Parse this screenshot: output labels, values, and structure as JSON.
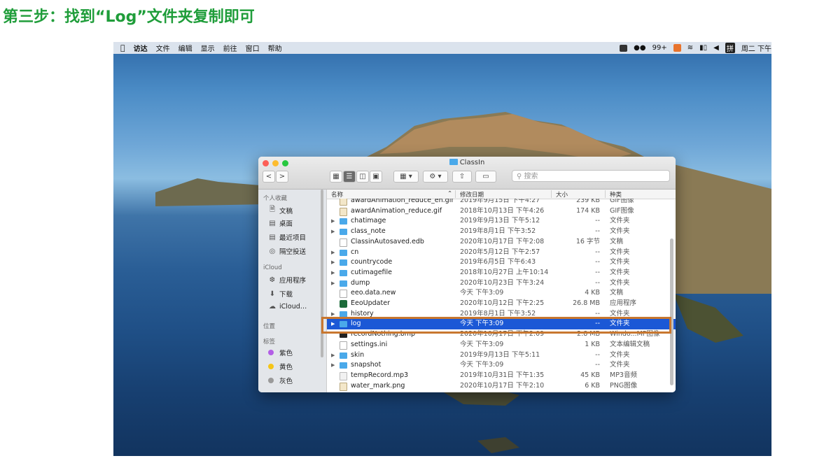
{
  "heading": "第三步：找到“Log”文件夹复制即可",
  "menubar": {
    "apple": "",
    "items": [
      "访达",
      "文件",
      "编辑",
      "显示",
      "前往",
      "窗口",
      "帮助"
    ],
    "badge": "99+",
    "input_method": "拼",
    "clock": "周二 下午"
  },
  "window": {
    "title": "ClassIn",
    "nav": {
      "back": "<",
      "forward": ">"
    },
    "search_placeholder": "搜索"
  },
  "sidebar": {
    "sections": [
      {
        "title": "个人收藏",
        "items": [
          {
            "label": "文稿",
            "icon": "documents-icon"
          },
          {
            "label": "桌面",
            "icon": "desktop-icon"
          },
          {
            "label": "最近项目",
            "icon": "recents-icon"
          },
          {
            "label": "隔空投送",
            "icon": "airdrop-icon"
          }
        ]
      },
      {
        "title": "iCloud",
        "items": [
          {
            "label": "应用程序",
            "icon": "applications-icon"
          },
          {
            "label": "下载",
            "icon": "downloads-icon"
          },
          {
            "label": "iCloud…",
            "icon": "icloud-icon"
          }
        ]
      },
      {
        "title": "位置",
        "items": []
      },
      {
        "title": "标签",
        "items": [
          {
            "label": "紫色",
            "color": "#b35ee6"
          },
          {
            "label": "黄色",
            "color": "#f5c518"
          },
          {
            "label": "灰色",
            "color": "#9a9a9a"
          }
        ]
      }
    ]
  },
  "columns": {
    "name": "名称",
    "date": "修改日期",
    "size": "大小",
    "kind": "种类"
  },
  "rows": [
    {
      "name": "awardAnimation_reduce_en.gif",
      "date": "2019年9月15日 下午4:27",
      "size": "239 KB",
      "kind": "GIF图像",
      "type": "img",
      "expandable": false
    },
    {
      "name": "awardAnimation_reduce.gif",
      "date": "2018年10月13日 下午4:26",
      "size": "174 KB",
      "kind": "GIF图像",
      "type": "img",
      "expandable": false
    },
    {
      "name": "chatimage",
      "date": "2019年9月13日 下午5:12",
      "size": "--",
      "kind": "文件夹",
      "type": "folder",
      "expandable": true
    },
    {
      "name": "class_note",
      "date": "2019年8月1日 下午3:52",
      "size": "--",
      "kind": "文件夹",
      "type": "folder",
      "expandable": true
    },
    {
      "name": "ClassinAutosaved.edb",
      "date": "2020年10月17日 下午2:08",
      "size": "16 字节",
      "kind": "文稿",
      "type": "doc",
      "expandable": false
    },
    {
      "name": "cn",
      "date": "2020年5月12日 下午2:57",
      "size": "--",
      "kind": "文件夹",
      "type": "folder",
      "expandable": true
    },
    {
      "name": "countrycode",
      "date": "2019年6月5日 下午6:43",
      "size": "--",
      "kind": "文件夹",
      "type": "folder",
      "expandable": true
    },
    {
      "name": "cutimagefile",
      "date": "2018年10月27日 上午10:14",
      "size": "--",
      "kind": "文件夹",
      "type": "folder",
      "expandable": true
    },
    {
      "name": "dump",
      "date": "2020年10月23日 下午3:24",
      "size": "--",
      "kind": "文件夹",
      "type": "folder",
      "expandable": true
    },
    {
      "name": "eeo.data.new",
      "date": "今天 下午3:09",
      "size": "4 KB",
      "kind": "文稿",
      "type": "doc",
      "expandable": false
    },
    {
      "name": "EeoUpdater",
      "date": "2020年10月12日 下午2:25",
      "size": "26.8 MB",
      "kind": "应用程序",
      "type": "app",
      "expandable": false
    },
    {
      "name": "history",
      "date": "2019年8月1日 下午3:52",
      "size": "--",
      "kind": "文件夹",
      "type": "folder",
      "expandable": true
    },
    {
      "name": "log",
      "date": "今天 下午3:09",
      "size": "--",
      "kind": "文件夹",
      "type": "folder",
      "expandable": true,
      "selected": true
    },
    {
      "name": "recordNothing.bmp",
      "date": "2020年10月17日 下午2:09",
      "size": "2.8 MB",
      "kind": "Windo...MP图像",
      "type": "bmp",
      "expandable": false
    },
    {
      "name": "settings.ini",
      "date": "今天 下午3:09",
      "size": "1 KB",
      "kind": "文本编辑文稿",
      "type": "doc",
      "expandable": false
    },
    {
      "name": "skin",
      "date": "2019年9月13日 下午5:11",
      "size": "--",
      "kind": "文件夹",
      "type": "folder",
      "expandable": true
    },
    {
      "name": "snapshot",
      "date": "今天 下午3:09",
      "size": "--",
      "kind": "文件夹",
      "type": "folder",
      "expandable": true
    },
    {
      "name": "tempRecord.mp3",
      "date": "2019年10月31日 下午1:35",
      "size": "45 KB",
      "kind": "MP3音频",
      "type": "mp3",
      "expandable": false
    },
    {
      "name": "water_mark.png",
      "date": "2020年10月17日 下午2:10",
      "size": "6 KB",
      "kind": "PNG图像",
      "type": "img",
      "expandable": false
    }
  ],
  "colors": {
    "heading": "#1f9d3a",
    "selection": "#1b58d6",
    "highlight_box": "#c8772f"
  }
}
